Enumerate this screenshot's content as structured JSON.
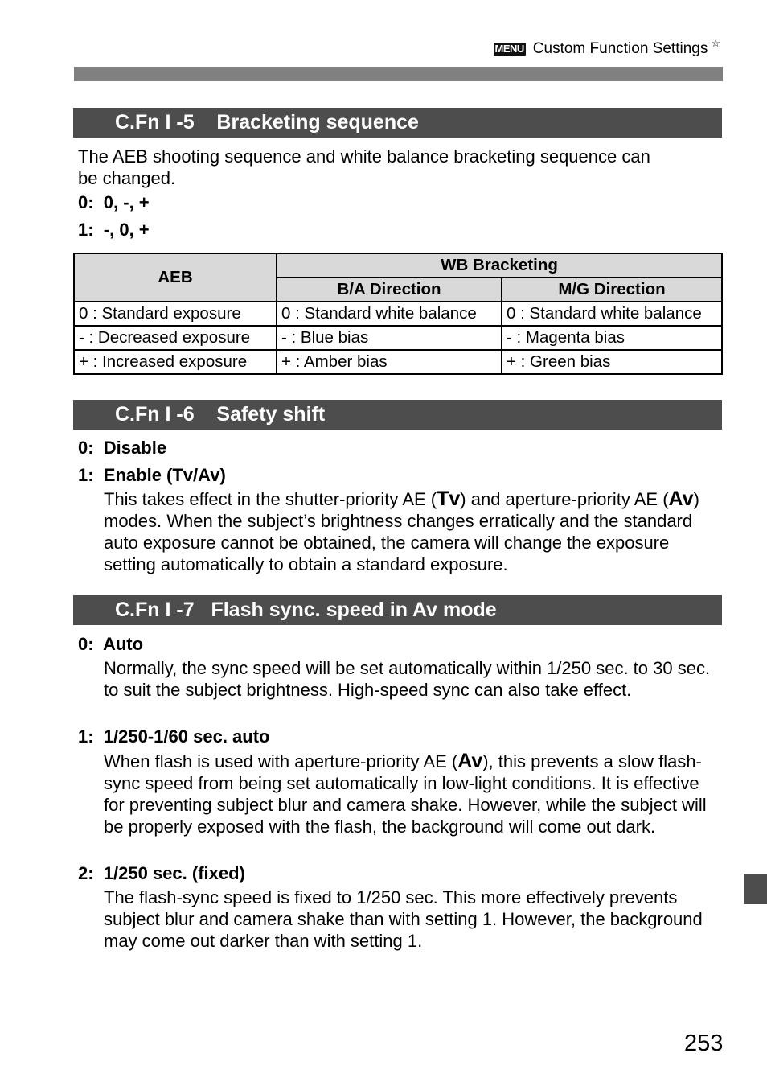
{
  "header": {
    "menu_badge": "MENU",
    "title": "Custom Function Settings",
    "star": "☆"
  },
  "sections": [
    {
      "code": "C.Fn I -5",
      "title": "Bracketing sequence",
      "intro_line1": "The AEB shooting sequence and white balance bracketing sequence can",
      "intro_line2": "be changed.",
      "options": [
        {
          "label": "0:",
          "value": "0, -, +"
        },
        {
          "label": "1:",
          "value": "-, 0, +"
        }
      ],
      "table": {
        "header_aeb": "AEB",
        "header_wb": "WB Bracketing",
        "header_ba": "B/A Direction",
        "header_mg": "M/G Direction",
        "rows": [
          [
            "0 : Standard exposure",
            "0 : Standard white balance",
            "0 : Standard white balance"
          ],
          [
            "-  : Decreased exposure",
            "-  : Blue bias",
            "-  : Magenta bias"
          ],
          [
            "+ : Increased exposure",
            "+ : Amber bias",
            "+ : Green bias"
          ]
        ]
      }
    },
    {
      "code": "C.Fn I -6",
      "title": "Safety shift",
      "options": [
        {
          "label": "0:",
          "value": "Disable"
        },
        {
          "label": "1:",
          "value": "Enable (Tv/Av)",
          "desc_a": "This takes effect in the shutter-priority AE (",
          "mode_tv": "Tv",
          "desc_b": ") and aperture-priority AE (",
          "mode_av": "Av",
          "desc_c": ") modes. When the subject’s brightness changes erratically and the standard auto exposure cannot be obtained, the camera will change the exposure setting automatically to obtain a standard exposure."
        }
      ]
    },
    {
      "code": "C.Fn I -7",
      "title": "Flash sync. speed in Av mode",
      "options": [
        {
          "label": "0:",
          "value": "Auto",
          "desc": "Normally, the sync speed will be set automatically within 1/250 sec. to 30 sec. to suit the subject brightness. High-speed sync can also take effect."
        },
        {
          "label": "1:",
          "value": "1/250-1/60 sec. auto",
          "desc_a": "When flash is used with aperture-priority AE (",
          "mode_av": "Av",
          "desc_b": "), this prevents a slow flash-sync speed from being set automatically in low-light conditions. It is effective for preventing subject blur and camera shake. However, while the subject will be properly exposed with the flash, the background will come out dark."
        },
        {
          "label": "2:",
          "value": "1/250 sec. (fixed)",
          "desc": "The flash-sync speed is fixed to 1/250 sec. This more effectively prevents subject blur and camera shake than with setting 1. However, the background may come out darker than with setting 1."
        }
      ]
    }
  ],
  "page_number": "253"
}
